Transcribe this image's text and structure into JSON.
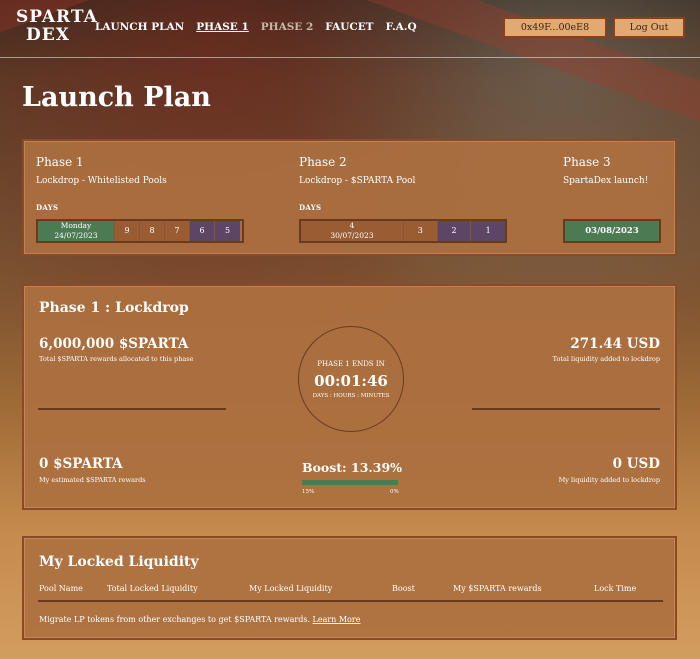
{
  "nav": {
    "logo_line1": "SPARTA",
    "logo_line2": "DEX",
    "links": [
      "LAUNCH PLAN",
      "PHASE 1",
      "PHASE 2",
      "FAUCET",
      "F.A.Q"
    ],
    "wallet_address": "0x49F...00eE8",
    "logout_label": "Log Out"
  },
  "page_title": "Launch Plan",
  "plan": {
    "phase1": {
      "title": "Phase 1",
      "subtitle": "Lockdrop - Whitelisted Pools",
      "days_label": "DAYS",
      "current_day": "Monday",
      "current_date": "24/07/2023",
      "days": [
        "9",
        "8",
        "7",
        "6",
        "5"
      ]
    },
    "phase2": {
      "title": "Phase 2",
      "subtitle": "Lockdrop - $SPARTA Pool",
      "days_label": "DAYS",
      "current_day": "4",
      "current_date": "30/07/2023",
      "days": [
        "3",
        "2",
        "1"
      ]
    },
    "phase3": {
      "title": "Phase 3",
      "subtitle": "SpartaDex launch!",
      "date": "03/08/2023"
    }
  },
  "lockdrop": {
    "title": "Phase 1 : Lockdrop",
    "total_rewards": "6,000,000 $SPARTA",
    "total_rewards_label": "Total $SPARTA rewards allocated to this phase",
    "total_liquidity": "271.44 USD",
    "total_liquidity_label": "Total liquidity added to lockdrop",
    "ends_label": "PHASE 1 ENDS IN",
    "countdown": "00:01:46",
    "countdown_units": "DAYS : HOURS : MINUTES",
    "my_rewards": "0 $SPARTA",
    "my_rewards_label": "My estimated $SPARTA rewards",
    "my_liquidity": "0 USD",
    "my_liquidity_label": "My liquidity added to lockdrop",
    "boost_label": "Boost: 13.39%",
    "boost_fraction": 0.1339,
    "boost_min": "15%",
    "boost_max": "0%"
  },
  "liquidity": {
    "title": "My Locked Liquidity",
    "columns": [
      "Pool Name",
      "Total Locked Liquidity",
      "My Locked Liquidity",
      "Boost",
      "My $SPARTA rewards",
      "Lock Time"
    ],
    "note": "Migrate LP tokens from other exchanges to get $SPARTA rewards.",
    "learn_more": "Learn More"
  }
}
